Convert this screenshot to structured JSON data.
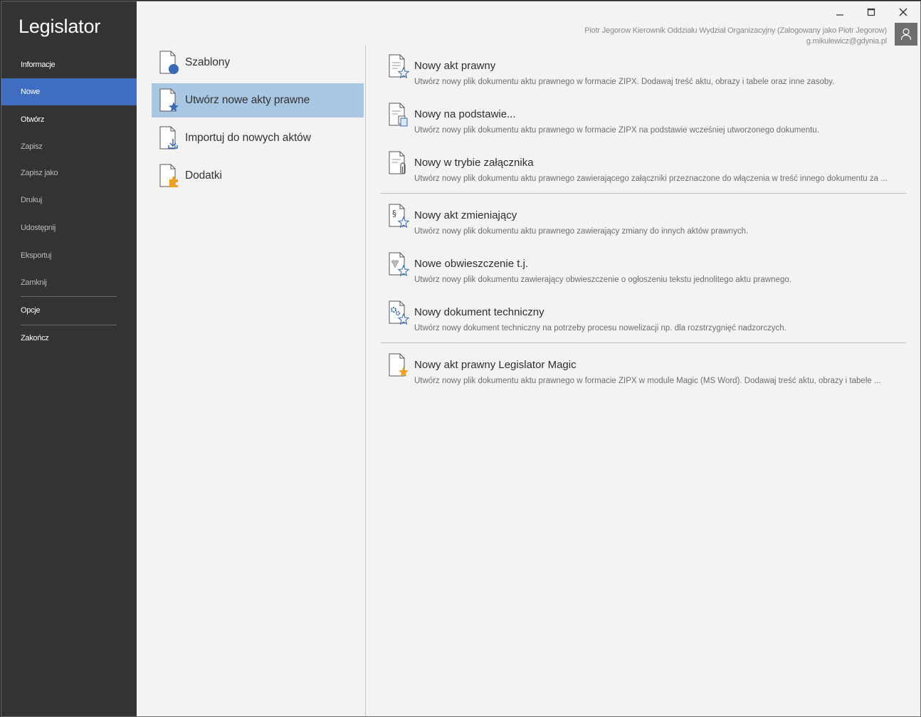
{
  "app": {
    "title": "Legislator"
  },
  "sidebar": {
    "items": [
      {
        "label": "Informacje"
      },
      {
        "label": "Nowe"
      },
      {
        "label": "Otwórz"
      },
      {
        "label": "Zapisz"
      },
      {
        "label": "Zapisz jako"
      },
      {
        "label": "Drukuj"
      },
      {
        "label": "Udostępnij"
      },
      {
        "label": "Eksportuj"
      },
      {
        "label": "Zamknij"
      },
      {
        "label": "Opcje"
      },
      {
        "label": "Zakończ"
      }
    ]
  },
  "user": {
    "line1": "Piotr Jegorow Kierownik Oddziału Wydział Organizacyjny (Zalogowany jako Piotr Jegorow)",
    "line2": "g.mikulewicz@gdynia.pl"
  },
  "categories": [
    {
      "label": "Szablony",
      "icon": "template-icon"
    },
    {
      "label": "Utwórz nowe akty prawne",
      "icon": "new-act-icon"
    },
    {
      "label": "Importuj do nowych aktów",
      "icon": "import-icon"
    },
    {
      "label": "Dodatki",
      "icon": "addon-icon"
    }
  ],
  "documents": [
    {
      "title": "Nowy akt prawny",
      "desc": "Utwórz nowy plik dokumentu aktu prawnego w formacie ZIPX. Dodawaj treść aktu, obrazy i tabele oraz inne zasoby."
    },
    {
      "title": "Nowy na podstawie...",
      "desc": "Utwórz nowy plik dokumentu aktu prawnego w formacie ZIPX na podstawie wcześniej utworzonego dokumentu."
    },
    {
      "title": "Nowy w trybie załącznika",
      "desc": "Utwórz nowy plik dokumentu aktu prawnego zawierającego załączniki przeznaczone do włączenia w treść innego dokumentu za ..."
    },
    {
      "title": "Nowy akt zmieniający",
      "desc": "Utwórz nowy plik dokumentu aktu prawnego zawierający zmiany do innych aktów prawnych."
    },
    {
      "title": "Nowe obwieszczenie t.j.",
      "desc": "Utwórz nowy plik dokumentu zawierający obwieszczenie o ogłoszeniu tekstu jednolitego aktu prawnego."
    },
    {
      "title": "Nowy dokument techniczny",
      "desc": "Utwórz nowy dokument techniczny na potrzeby procesu nowelizacji np. dla rozstrzygnięć nadzorczych."
    },
    {
      "title": "Nowy akt prawny Legislator Magic",
      "desc": "Utwórz nowy plik dokumentu aktu prawnego w formacie ZIPX w module Magic (MS Word). Dodawaj treść aktu, obrazy i tabele ..."
    }
  ],
  "icon_glyphs": {
    "paragraph": "§"
  },
  "colors": {
    "sidebar_bg": "#333333",
    "active_nav": "#3f6ec0",
    "active_category": "#a9c6e2",
    "accent_blue": "#3a6ab4",
    "accent_orange": "#f0a020"
  }
}
